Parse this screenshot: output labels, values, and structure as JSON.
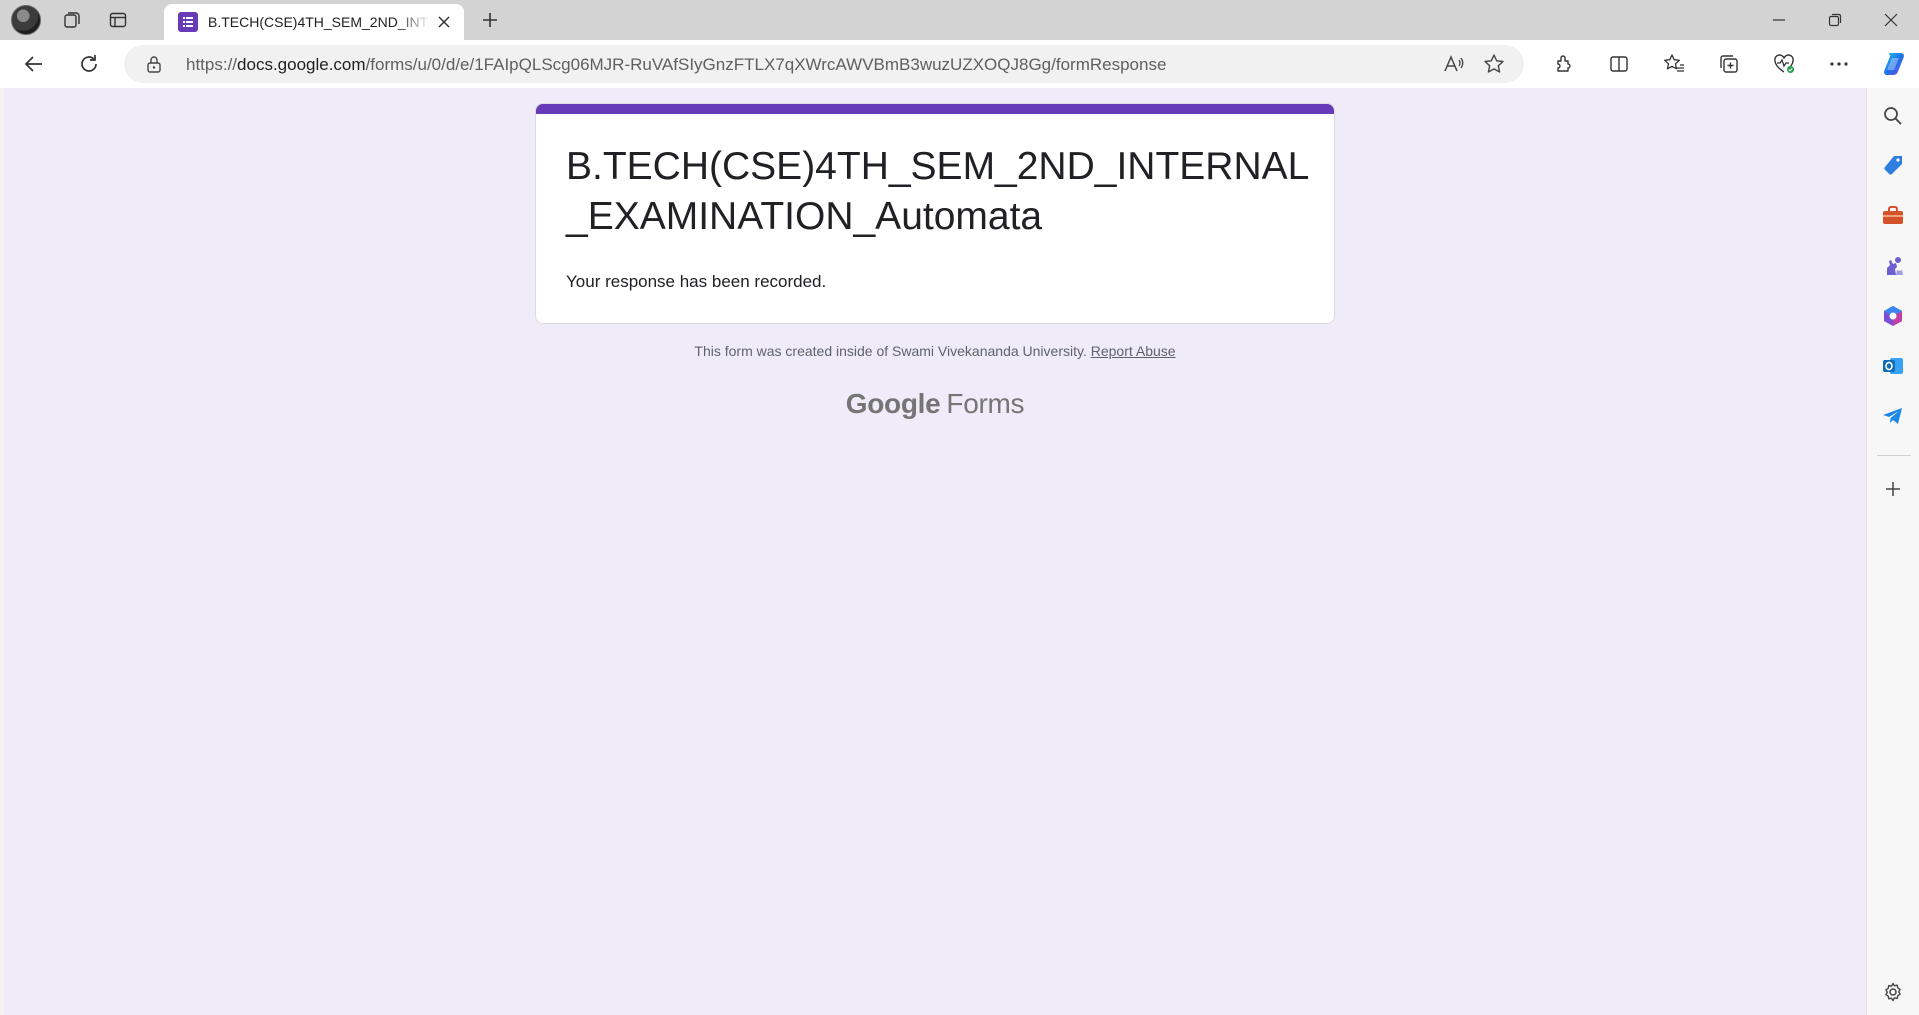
{
  "browser": {
    "tab": {
      "title": "B.TECH(CSE)4TH_SEM_2ND_INTERNAL_EXAMINATION_Automata",
      "favicon": "google-forms-icon"
    },
    "address": {
      "prefix": "https://",
      "host": "docs.google.com",
      "path": "/forms/u/0/d/e/1FAIpQLScg06MJR-RuVAfSIyGnzFTLX7qXWrcAWVBmB3wuzUZXOQJ8Gg/formResponse"
    },
    "toolbar_icons": [
      "read-aloud-icon",
      "favorite-star-icon",
      "extensions-icon",
      "split-screen-icon",
      "favorites-icon",
      "collections-icon",
      "browser-essentials-icon",
      "more-options-icon",
      "copilot-icon"
    ],
    "sidebar_icons": [
      "search-icon",
      "shopping-icon",
      "tools-icon",
      "games-icon",
      "microsoft365-icon",
      "outlook-icon",
      "telegram-icon",
      "add-icon",
      "settings-icon"
    ]
  },
  "form": {
    "title": "B.TECH(CSE)4TH_SEM_2ND_INTERNAL_EXAMINATION_Automata",
    "message": "Your response has been recorded.",
    "accent_color": "#673ab7",
    "background_color": "#efebf8"
  },
  "footer": {
    "note": "This form was created inside of Swami Vivekananda University.",
    "report_link": "Report Abuse",
    "brand_google": "Google",
    "brand_forms": "Forms"
  }
}
